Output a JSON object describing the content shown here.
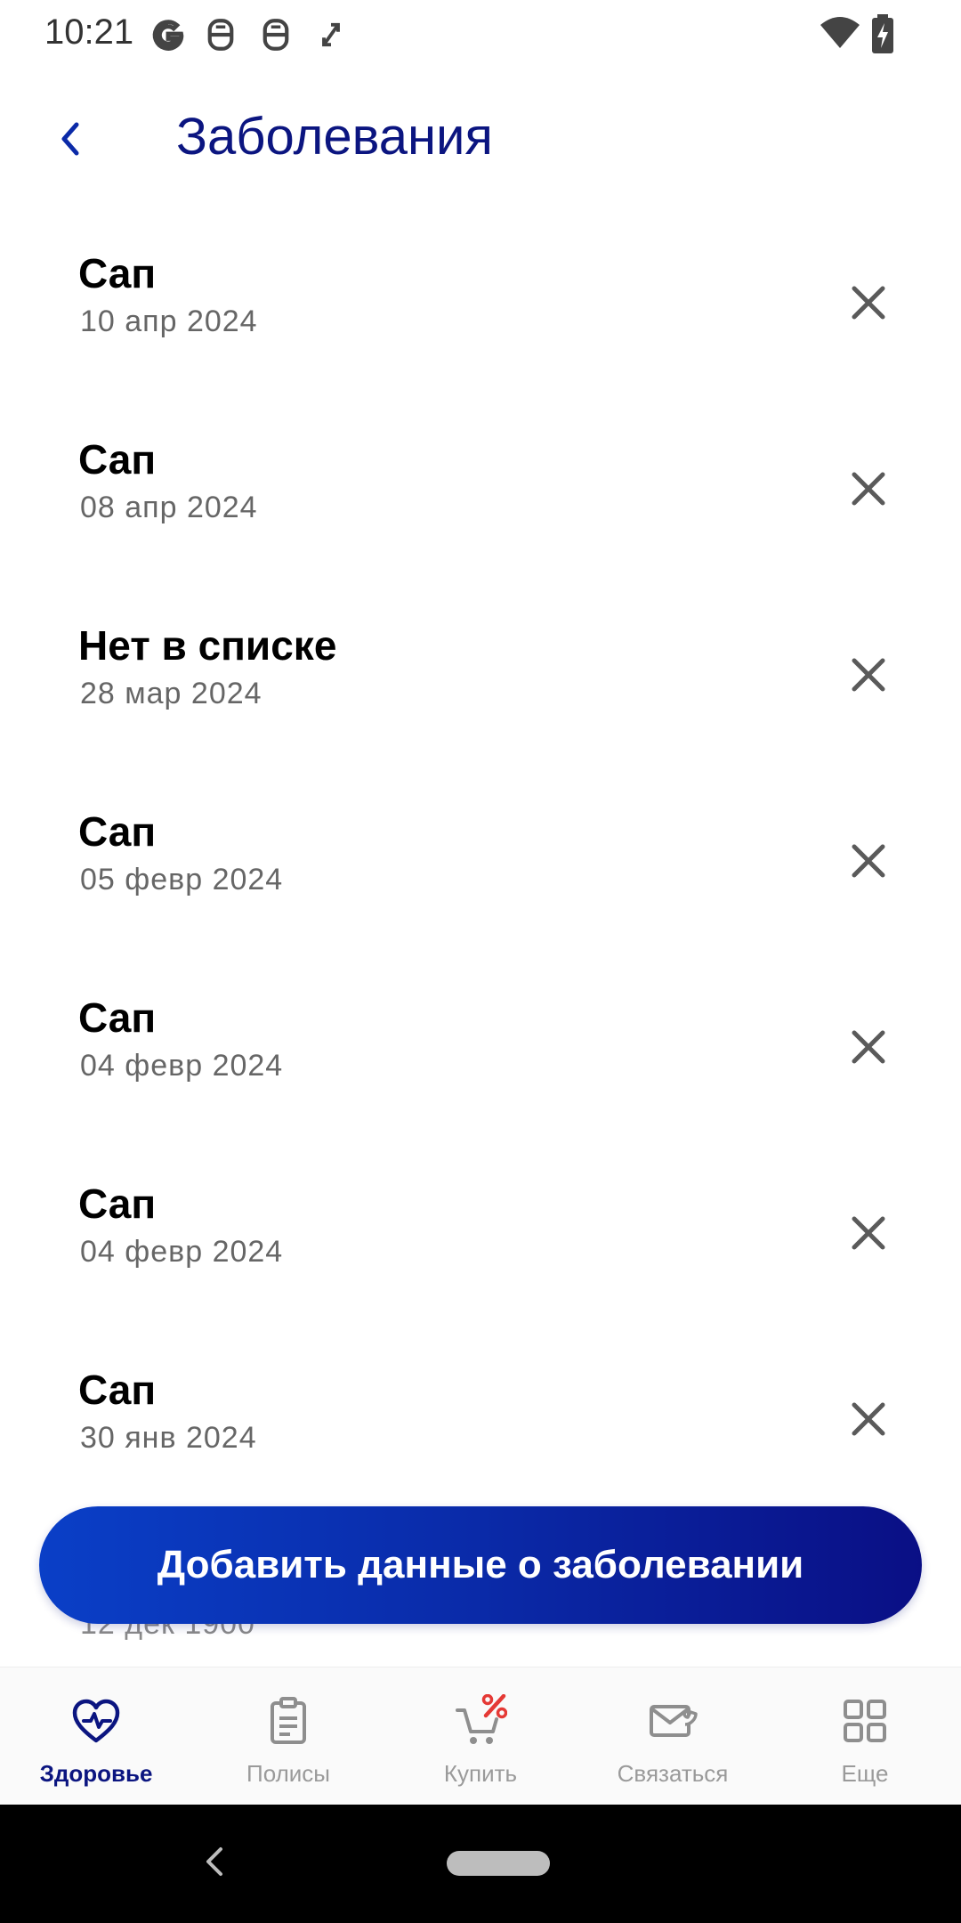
{
  "status_bar": {
    "time": "10:21",
    "left_icons": [
      "google-icon",
      "bug-icon",
      "bug-icon",
      "expand-icon"
    ],
    "right_icons": [
      "wifi-icon",
      "battery-charging-icon"
    ]
  },
  "header": {
    "title": "Заболевания",
    "back_icon": "chevron-left-icon"
  },
  "list": {
    "items": [
      {
        "title": "Сап",
        "date": "10 апр 2024"
      },
      {
        "title": "Сап",
        "date": "08 апр 2024"
      },
      {
        "title": "Нет в списке",
        "date": "28 мар 2024"
      },
      {
        "title": "Сап",
        "date": "05 февр 2024"
      },
      {
        "title": "Сап",
        "date": "04 февр 2024"
      },
      {
        "title": "Сап",
        "date": "04 февр 2024"
      },
      {
        "title": "Сап",
        "date": "30 янв 2024"
      }
    ],
    "partial_item_date": "12 дек 1900",
    "remove_icon": "close-icon"
  },
  "primary_button": {
    "label": "Добавить данные о заболевании"
  },
  "bottom_nav": {
    "items": [
      {
        "label": "Здоровье",
        "icon": "heart-pulse-icon",
        "active": true
      },
      {
        "label": "Полисы",
        "icon": "clipboard-icon",
        "active": false
      },
      {
        "label": "Купить",
        "icon": "cart-percent-icon",
        "active": false
      },
      {
        "label": "Связаться",
        "icon": "mail-phone-icon",
        "active": false
      },
      {
        "label": "Еще",
        "icon": "grid-icon",
        "active": false
      }
    ]
  },
  "colors": {
    "accent": "#0b1580",
    "button_gradient_start": "#0a3fc7",
    "button_gradient_end": "#0a0f85",
    "promo_red": "#e53935",
    "muted": "#9a9a9a"
  }
}
